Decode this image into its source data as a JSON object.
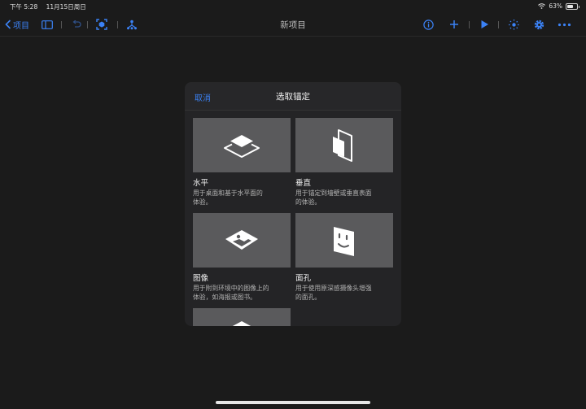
{
  "status_bar": {
    "time": "下午 5:28",
    "date": "11月15日周日",
    "battery": "63%",
    "battery_level": 0.63,
    "icons": [
      "wifi-icon",
      "battery-icon"
    ]
  },
  "toolbar": {
    "back_label": "项目",
    "title": "新项目",
    "icons": [
      "sidebar-icon",
      "undo-icon",
      "ar-scan-icon",
      "anchor-tree-icon",
      "info-icon",
      "add-icon",
      "play-icon",
      "behaviors-icon",
      "settings-icon",
      "more-icon"
    ]
  },
  "colors": {
    "accent": "#3b82f6",
    "background": "#1b1b1b",
    "sheet": "#242426",
    "tile": "#5a5a5c"
  },
  "sheet": {
    "cancel_label": "取消",
    "title": "选取锚定",
    "anchors": [
      {
        "name": "水平",
        "desc_lines": [
          "用于桌面和基于水平面的",
          "体验。"
        ],
        "icon": "horizontal-plane-icon"
      },
      {
        "name": "垂直",
        "desc_lines": [
          "用于锚定到墙壁或垂直表面",
          "的体验。"
        ],
        "icon": "vertical-plane-icon"
      },
      {
        "name": "图像",
        "desc_lines": [
          "用于附到环境中的图像上的",
          "体验，如海报或图书。"
        ],
        "icon": "image-anchor-icon"
      },
      {
        "name": "面孔",
        "desc_lines": [
          "用于使用原深感摄像头增强",
          "的面孔。"
        ],
        "icon": "face-anchor-icon"
      },
      {
        "name": "",
        "desc_lines": [],
        "icon": "object-anchor-icon"
      }
    ]
  }
}
